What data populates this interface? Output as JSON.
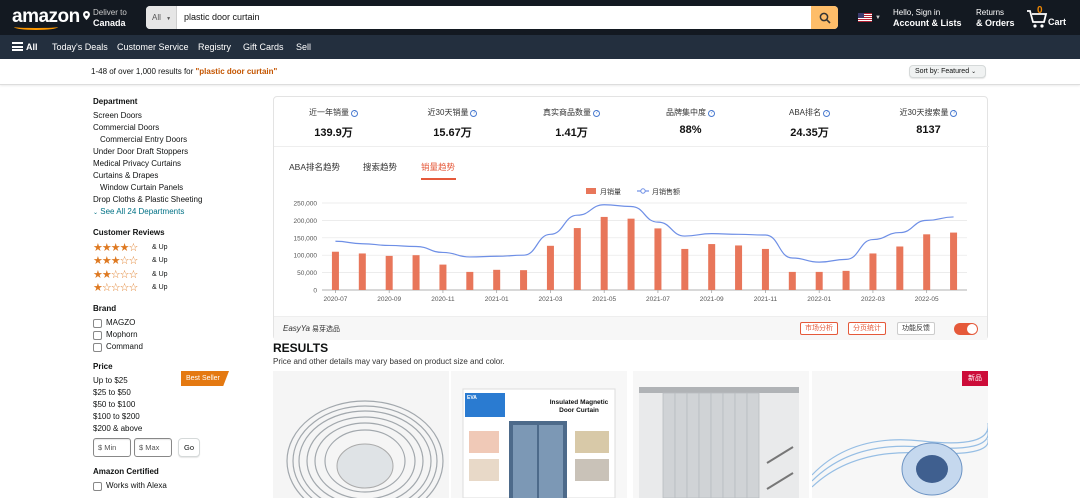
{
  "header": {
    "logo": "amazon",
    "deliver_label": "Deliver to",
    "deliver_location": "Canada",
    "search_category": "All",
    "search_value": "plastic door curtain",
    "account_line1": "Hello, Sign in",
    "account_line2": "Account & Lists",
    "returns_line1": "Returns",
    "returns_line2": "& Orders",
    "cart_count": "0",
    "cart_label": "Cart"
  },
  "subnav": {
    "all": "All",
    "items": [
      "Today's Deals",
      "Customer Service",
      "Registry",
      "Gift Cards",
      "Sell"
    ]
  },
  "results_bar": {
    "count_text": "1-48 of over 1,000 results for ",
    "query": "\"plastic door curtain\"",
    "sort_label": "Sort by:",
    "sort_value": "Featured"
  },
  "sidebar": {
    "department_title": "Department",
    "departments": [
      "Screen Doors",
      "Commercial Doors",
      "Commercial Entry Doors",
      "Under Door Draft Stoppers",
      "Medical Privacy Curtains",
      "Curtains & Drapes",
      "Window Curtain Panels",
      "Drop Cloths & Plastic Sheeting"
    ],
    "see_all": "See All 24 Departments",
    "reviews_title": "Customer Reviews",
    "reviews_up": "& Up",
    "brand_title": "Brand",
    "brands": [
      "MAGZO",
      "Mophorn",
      "Command"
    ],
    "price_title": "Price",
    "prices": [
      "Up to $25",
      "$25 to $50",
      "$50 to $100",
      "$100 to $200",
      "$200 & above"
    ],
    "min_placeholder": "$ Min",
    "max_placeholder": "$ Max",
    "go": "Go",
    "certified_title": "Amazon Certified",
    "certified_option": "Works with Alexa"
  },
  "stats": [
    {
      "label": "近一年销量",
      "value": "139.9万"
    },
    {
      "label": "近30天销量",
      "value": "15.67万"
    },
    {
      "label": "真实商品数量",
      "value": "1.41万"
    },
    {
      "label": "品牌集中度",
      "value": "88%"
    },
    {
      "label": "ABA排名",
      "value": "24.35万"
    },
    {
      "label": "近30天搜索量",
      "value": "8137"
    }
  ],
  "tabs": [
    "ABA排名趋势",
    "搜索趋势",
    "销量趋势"
  ],
  "panel_footer": {
    "brand": "EasyYa",
    "brand_sub": "易芽选品",
    "btn1": "市场分析",
    "btn2": "分页统计",
    "btn3": "功能反馈"
  },
  "chart_data": {
    "type": "bar",
    "legend": [
      "月销量",
      "月销售额"
    ],
    "x_tick_labels": [
      "2020-07",
      "2020-09",
      "2020-11",
      "2021-01",
      "2021-03",
      "2021-05",
      "2021-07",
      "2021-09",
      "2021-11",
      "2022-01",
      "2022-03",
      "2022-05"
    ],
    "y_tick_labels": [
      "0",
      "50,000",
      "100,000",
      "150,000",
      "200,000",
      "250,000"
    ],
    "ylim": [
      0,
      250000
    ],
    "categories": [
      "2020-07",
      "2020-08",
      "2020-09",
      "2020-10",
      "2020-11",
      "2020-12",
      "2021-01",
      "2021-02",
      "2021-03",
      "2021-04",
      "2021-05",
      "2021-06",
      "2021-07",
      "2021-08",
      "2021-09",
      "2021-10",
      "2021-11",
      "2021-12",
      "2022-01",
      "2022-02",
      "2022-03",
      "2022-04",
      "2022-05",
      "2022-06"
    ],
    "series": [
      {
        "name": "月销量",
        "type": "bar",
        "values": [
          110000,
          105000,
          98000,
          100000,
          73000,
          52000,
          58000,
          57000,
          127000,
          178000,
          210000,
          205000,
          177000,
          118000,
          132000,
          128000,
          118000,
          52000,
          52000,
          55000,
          105000,
          125000,
          160000,
          165000
        ]
      },
      {
        "name": "月销售额",
        "type": "line",
        "values": [
          140000,
          133000,
          128000,
          125000,
          108000,
          95000,
          97000,
          100000,
          160000,
          215000,
          245000,
          240000,
          195000,
          155000,
          162000,
          160000,
          158000,
          92000,
          80000,
          88000,
          145000,
          165000,
          200000,
          210000
        ]
      }
    ],
    "colors": {
      "bar": "#e8765a",
      "line": "#6e8fe6"
    }
  },
  "results": {
    "title": "RESULTS",
    "subtitle": "Price and other details may vary based on product size and color.",
    "badge_best_seller": "Best Seller",
    "badge_new": "新品",
    "product2_title": "Insulated Magnetic Door Curtain",
    "product2_tag": "EVA"
  }
}
